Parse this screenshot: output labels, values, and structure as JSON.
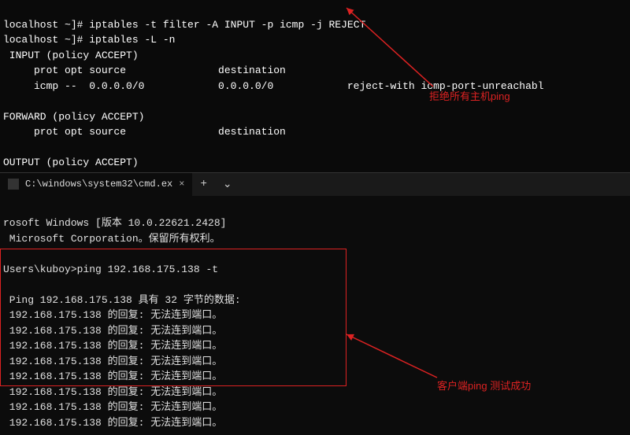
{
  "linux": {
    "prompt": "localhost ~]#",
    "cmd1": "iptables -t filter -A INPUT -p icmp -j REJECT",
    "cmd2": "iptables -L -n",
    "chain_input": " INPUT (policy ACCEPT)",
    "header1": "     prot opt source               destination",
    "rule1": "     icmp --  0.0.0.0/0            0.0.0.0/0            reject-with icmp-port-unreachabl",
    "chain_forward": "FORWARD (policy ACCEPT)",
    "header2": "     prot opt source               destination",
    "chain_output": "OUTPUT (policy ACCEPT)"
  },
  "tab": {
    "title": "C:\\windows\\system32\\cmd.ex",
    "close": "×",
    "add": "+",
    "chev": "⌄"
  },
  "cmd": {
    "version": "rosoft Windows [版本 10.0.22621.2428]",
    "copyright": " Microsoft Corporation。保留所有权利。",
    "prompt": "Users\\kuboy>",
    "ping_cmd": "ping 192.168.175.138 -t",
    "ping_header": " Ping 192.168.175.138 具有 32 字节的数据:",
    "replies": [
      " 192.168.175.138 的回复: 无法连到端口。",
      " 192.168.175.138 的回复: 无法连到端口。",
      " 192.168.175.138 的回复: 无法连到端口。",
      " 192.168.175.138 的回复: 无法连到端口。",
      " 192.168.175.138 的回复: 无法连到端口。",
      " 192.168.175.138 的回复: 无法连到端口。",
      " 192.168.175.138 的回复: 无法连到端口。",
      " 192.168.175.138 的回复: 无法连到端口。"
    ]
  },
  "annotations": {
    "top": "拒绝所有主机ping",
    "bottom": "客户端ping 测试成功"
  }
}
